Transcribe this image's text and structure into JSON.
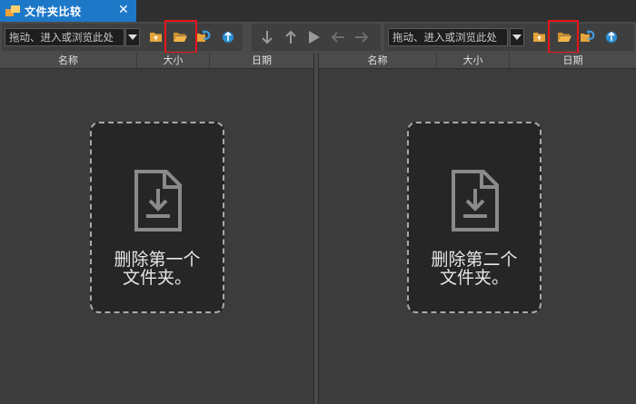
{
  "tab": {
    "title": "文件夹比较",
    "close": "✕"
  },
  "left": {
    "path_placeholder": "拖动、进入或浏览此处",
    "columns": [
      "名称",
      "大小",
      "日期"
    ],
    "drop_line1": "删除第一个",
    "drop_line2": "文件夹。"
  },
  "right": {
    "path_placeholder": "拖动、进入或浏览此处",
    "columns": [
      "名称",
      "大小",
      "日期"
    ],
    "drop_line1": "删除第二个",
    "drop_line2": "文件夹。"
  },
  "nav": {
    "icons": [
      "arrow-down-icon",
      "arrow-up-icon",
      "play-icon",
      "arrow-left-icon",
      "arrow-right-icon"
    ]
  },
  "colors": {
    "tab_accent": "#1e78c8",
    "highlight": "#e8131b",
    "folder": "#e6a43a"
  }
}
